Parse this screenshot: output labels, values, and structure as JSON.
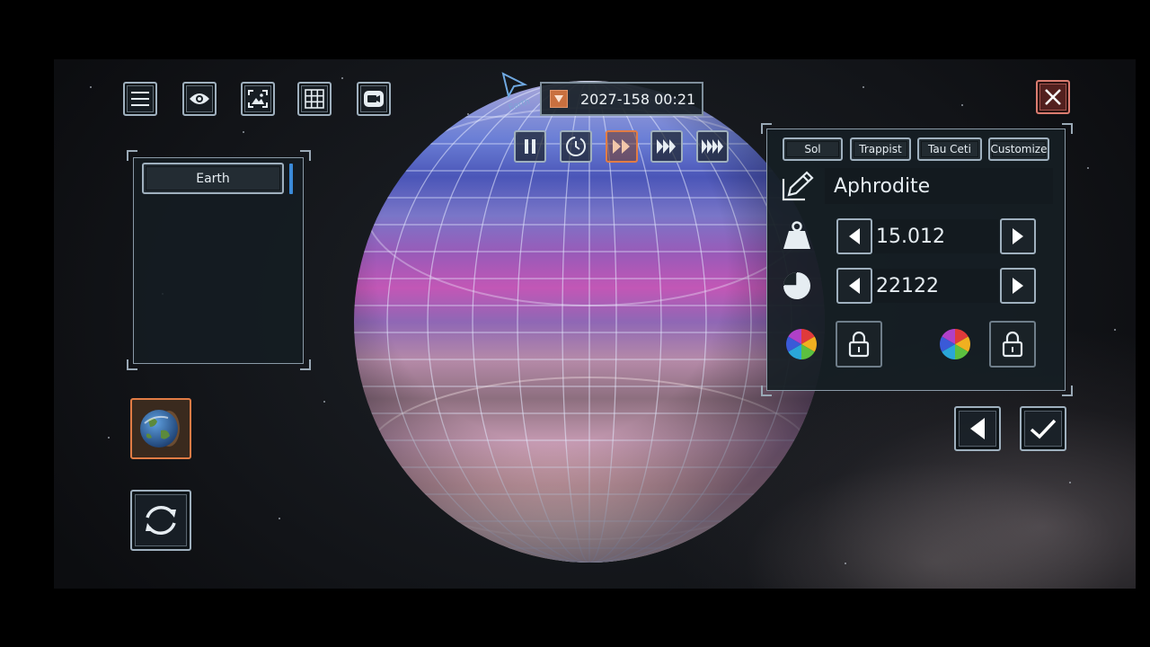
{
  "top_toolbar": {
    "menu_icon": "menu-icon",
    "eye_icon": "eye-icon",
    "image_icon": "image-icon",
    "grid_icon": "grid-icon",
    "camera_icon": "camera-icon"
  },
  "cursor_label": "Earth",
  "time_bar": {
    "date": "2027-158 00:21",
    "controls": [
      "pause-icon",
      "clock-icon",
      "fast-forward-icon",
      "fast-forward-2-icon",
      "fast-forward-3-icon"
    ],
    "active_speed": "fast-forward"
  },
  "object_list": {
    "items": [
      "Earth"
    ]
  },
  "editor_panel": {
    "tabs": [
      "Sol",
      "Trappist",
      "Tau Ceti",
      "Customize"
    ],
    "name": "Aphrodite",
    "mass_value": "15.012",
    "radius_value": "22122"
  },
  "colors": {
    "accent_orange": "#e27c45",
    "close_red": "#d97b6f",
    "frame": "#9fb0be"
  }
}
